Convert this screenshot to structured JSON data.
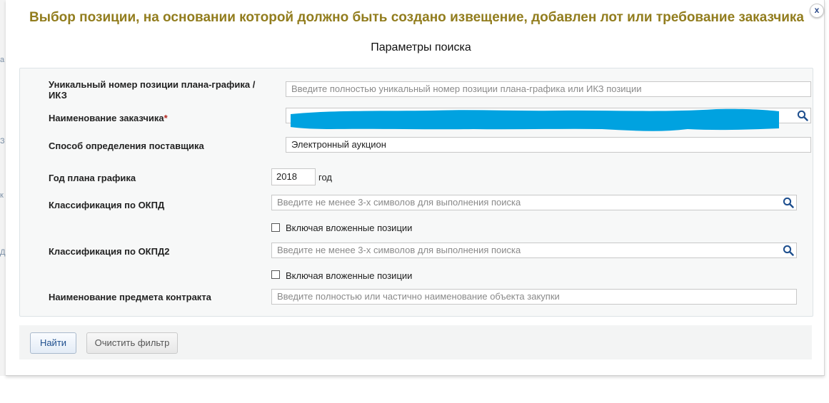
{
  "dialog": {
    "title": "Выбор позиции, на основании которой должно быть создано извещение, добавлен лот или требование заказчика",
    "close_label": "x",
    "section_title": "Параметры поиска"
  },
  "form": {
    "position_number": {
      "label": "Уникальный номер позиции плана-графика / ИКЗ",
      "placeholder": "Введите полностью уникальный номер позиции плана-графика или ИКЗ позиции"
    },
    "customer_name": {
      "label": "Наименование заказчика",
      "required_mark": "*",
      "redaction_color": "#00a2e0"
    },
    "supplier_method": {
      "label": "Способ определения поставщика",
      "value": "Электронный аукцион"
    },
    "plan_year": {
      "label": "Год плана графика",
      "value": "2018",
      "suffix": "год"
    },
    "okpd": {
      "label": "Классификация по ОКПД",
      "placeholder": "Введите не менее 3-х символов для выполнения поиска",
      "include_nested_label": "Включая вложенные позиции",
      "include_nested_checked": false
    },
    "okpd2": {
      "label": "Классификация по ОКПД2",
      "placeholder": "Введите не менее 3-х символов для выполнения поиска",
      "include_nested_label": "Включая вложенные позиции",
      "include_nested_checked": false
    },
    "contract_subject": {
      "label": "Наименование предмета контракта",
      "placeholder": "Введите полностью или частично наименование объекта закупки"
    }
  },
  "buttons": {
    "find": "Найти",
    "clear_filter": "Очистить фильтр"
  },
  "colors": {
    "title": "#927d1e",
    "accent": "#1e4f8e"
  }
}
